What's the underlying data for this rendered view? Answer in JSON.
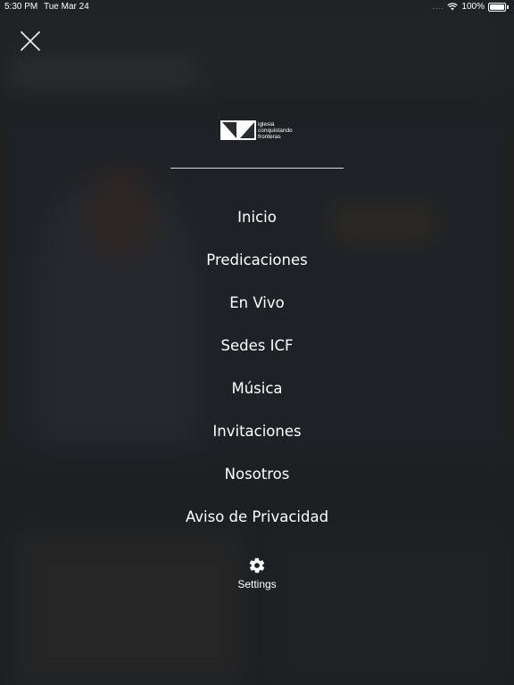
{
  "status_bar": {
    "time": "5:30 PM",
    "date": "Tue Mar 24",
    "signal": "....",
    "battery": "100%"
  },
  "close_icon": "close-icon",
  "logo": {
    "line1": "iglesia",
    "line2": "conquistando",
    "line3": "fronteras"
  },
  "menu": {
    "items": [
      {
        "label": "Inicio"
      },
      {
        "label": "Predicaciones"
      },
      {
        "label": "En Vivo"
      },
      {
        "label": "Sedes ICF"
      },
      {
        "label": "Música"
      },
      {
        "label": "Invitaciones"
      },
      {
        "label": "Nosotros"
      },
      {
        "label": "Aviso de Privacidad"
      }
    ]
  },
  "settings": {
    "label": "Settings",
    "icon": "gear-icon"
  },
  "colors": {
    "overlay": "#2a2c2f",
    "text": "#ffffff",
    "divider": "#d8d8d8"
  }
}
